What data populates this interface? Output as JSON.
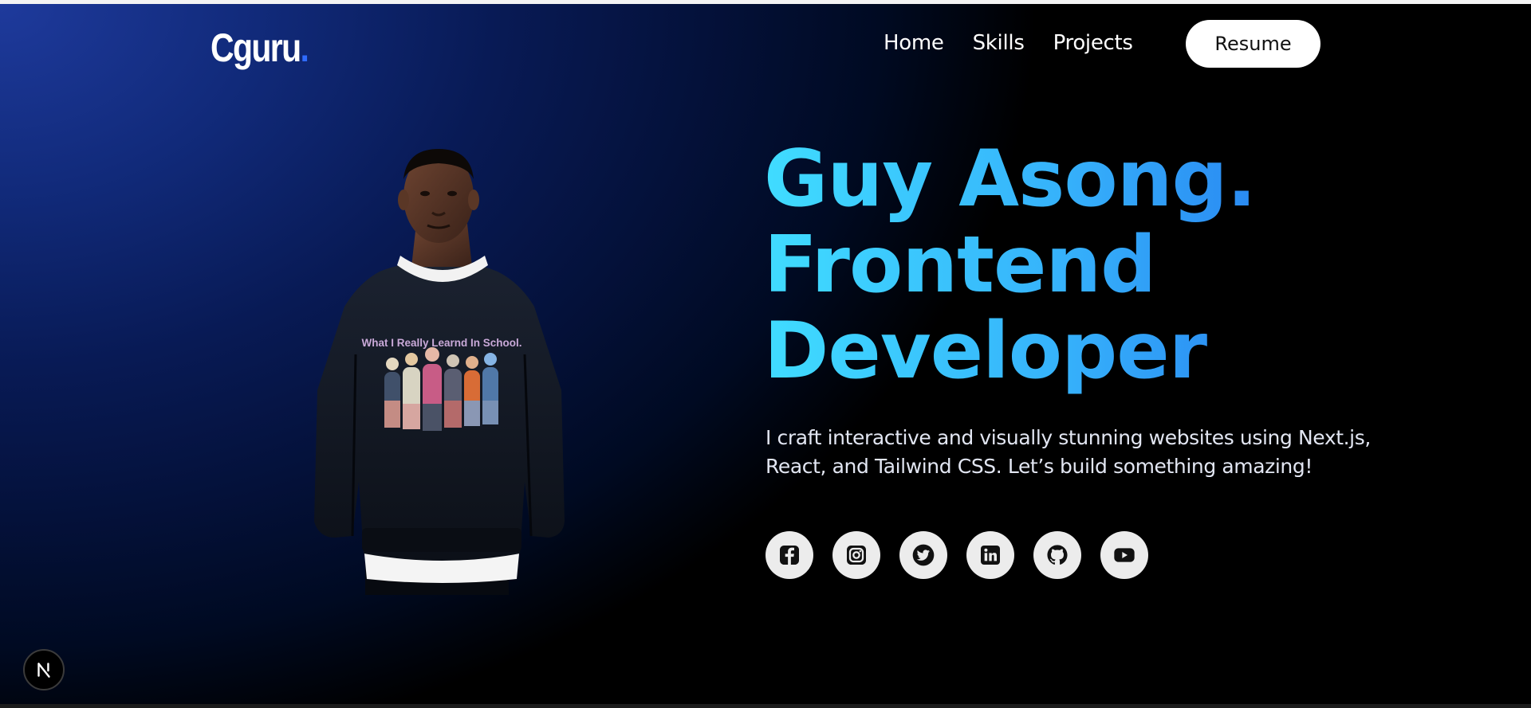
{
  "brand": {
    "logo_text": "Cguru",
    "logo_dot": ".",
    "accent_color": "#2f6bff"
  },
  "nav": {
    "items": [
      {
        "label": "Home"
      },
      {
        "label": "Skills"
      },
      {
        "label": "Projects"
      }
    ],
    "resume_label": "Resume"
  },
  "hero": {
    "name_line": "Guy Asong.",
    "role_line1": "Frontend",
    "role_line2": "Developer",
    "tagline": "I craft interactive and visually stunning websites using Next.js, React, and Tailwind CSS. Let’s build something amazing!",
    "gradient_colors": [
      "#40dcff",
      "#2a8af2"
    ],
    "portrait": {
      "shirt_text": "What I Really Learnd In School."
    }
  },
  "socials": [
    {
      "icon": "facebook-icon"
    },
    {
      "icon": "instagram-icon"
    },
    {
      "icon": "twitter-icon"
    },
    {
      "icon": "linkedin-icon"
    },
    {
      "icon": "github-icon"
    },
    {
      "icon": "youtube-icon"
    }
  ],
  "dev_badge": {
    "icon": "nextjs-icon"
  }
}
